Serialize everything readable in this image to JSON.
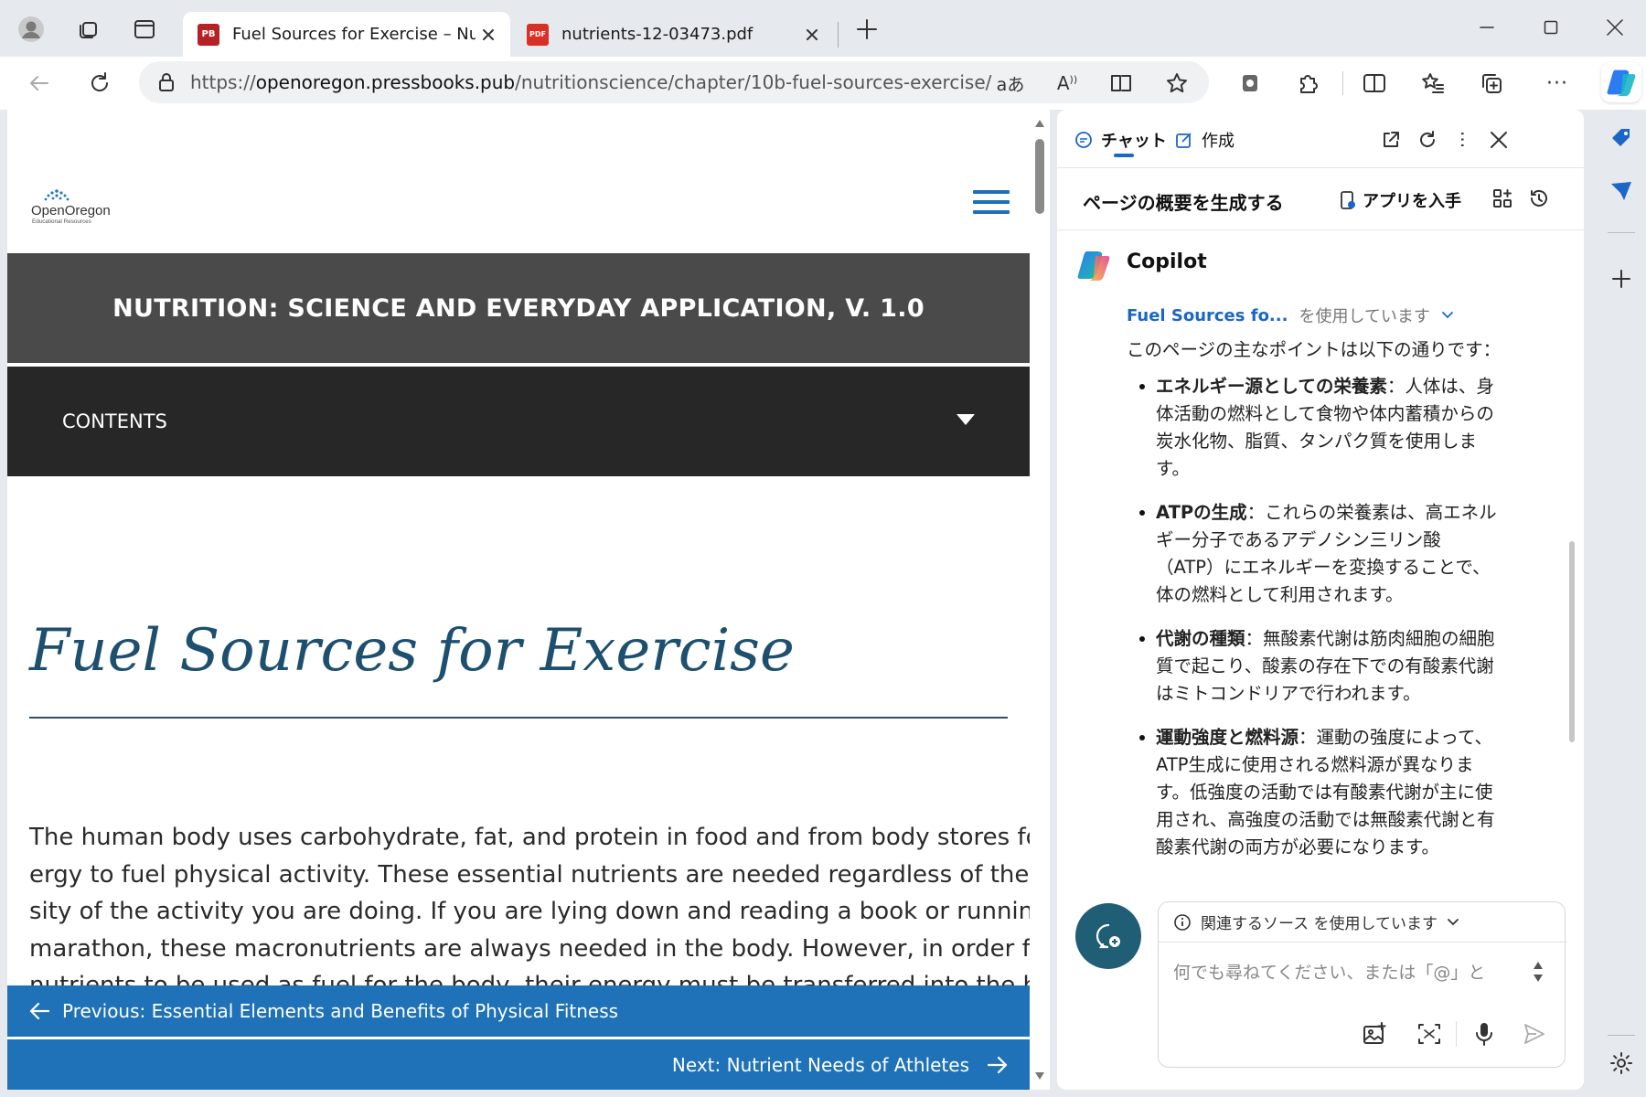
{
  "tabs": [
    {
      "title": "Fuel Sources for Exercise – Nutrit",
      "favicon": "PB",
      "active": true
    },
    {
      "title": "nutrients-12-03473.pdf",
      "favicon": "PDF",
      "active": false
    }
  ],
  "address_bar": {
    "url_prefix": "https://",
    "url_host": "openoregon.pressbooks.pub",
    "url_path": "/nutritionscience/chapter/10b-fuel-sources-exercise/"
  },
  "colors": {
    "brand_blue": "#1f72b8",
    "title_bar": "#4a4a4a",
    "contents_bar": "#272727",
    "heading": "#1d4f6e"
  },
  "page": {
    "book_title": "NUTRITION: SCIENCE AND EVERYDAY APPLICATION, V. 1.0",
    "contents_label": "CONTENTS",
    "chapter_title": "Fuel Sources for Exercise",
    "paragraph_lines": [
      "The human body uses carbohydrate, fat, and protein in food and from body stores for en-",
      "ergy to fuel physical activity. These essential nutrients are needed regardless of the inten-",
      "sity of the activity you are doing. If you are lying down and reading a book or running a",
      "marathon, these macronutrients are always needed in the body. However, in order for these",
      "nutrients to be used as fuel for the body, their energy must be transferred into the high en-"
    ],
    "prev_link": "Previous: Essential Elements and Benefits of Physical Fitness",
    "next_link": "Next: Nutrient Needs of Athletes"
  },
  "copilot": {
    "tab_chat": "チャット",
    "tab_compose": "作成",
    "summarize_label": "ページの概要を生成する",
    "get_app_label": "アプリを入手",
    "assistant_name": "Copilot",
    "source_link": "Fuel Sources fo...",
    "source_suffix": "を使用しています",
    "intro": "このページの主なポイントは以下の通りです：",
    "bullets": [
      {
        "term": "エネルギー源としての栄養素",
        "lines": [
          "：人体は、身",
          "体活動の燃料として食物や体内蓄積からの",
          "炭水化物、脂質、タンパク質を使用しま",
          "す。"
        ]
      },
      {
        "term": "ATPの生成",
        "lines": [
          "：これらの栄養素は、高エネル",
          "ギー分子であるアデノシン三リン酸",
          "（ATP）にエネルギーを変換することで、",
          "体の燃料として利用されます。"
        ]
      },
      {
        "term": "代謝の種類",
        "lines": [
          "：無酸素代謝は筋肉細胞の細胞",
          "質で起こり、酸素の存在下での有酸素代謝",
          "はミトコンドリアで行われます。"
        ]
      },
      {
        "term": "運動強度と燃料源",
        "lines": [
          "：運動の強度によって、",
          "ATP生成に使用される燃料源が異なりま",
          "す。低強度の活動では有酸素代謝が主に使",
          "用され、高強度の活動では無酸素代謝と有",
          "酸素代謝の両方が必要になります。"
        ]
      }
    ],
    "composer_sources": "関連するソース を使用しています",
    "composer_placeholder": "何でも尋ねてください、または「@」と"
  },
  "logo": {
    "name": "OpenOregon",
    "sub": "Educational Resources"
  }
}
